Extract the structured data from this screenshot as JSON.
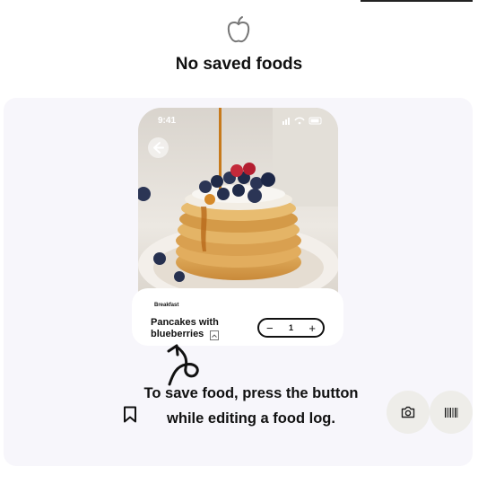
{
  "empty_state": {
    "title": "No saved foods",
    "icon": "apple-icon"
  },
  "tutorial": {
    "phone": {
      "status_time": "9:41",
      "category": "Breakfast",
      "food_name": "Pancakes with blueberries",
      "quantity": "1",
      "decrement_label": "−",
      "increment_label": "+"
    },
    "hint_text": "To save food, press the button while editing a food log.",
    "hint_icon": "bookmark-icon"
  },
  "actions": {
    "camera_icon": "camera-icon",
    "barcode_icon": "barcode-icon"
  },
  "colors": {
    "card_background": "#f7f6fb",
    "round_button_background": "#eeede9",
    "text": "#111111"
  }
}
